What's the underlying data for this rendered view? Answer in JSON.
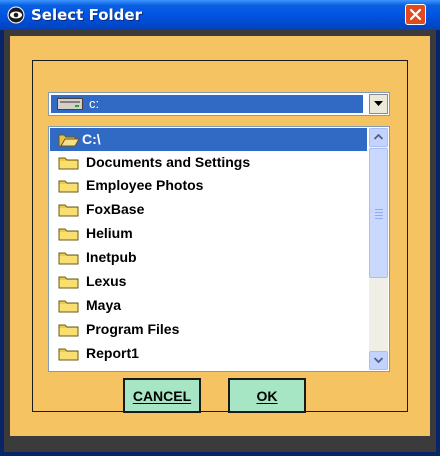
{
  "window": {
    "title": "Select Folder",
    "icons": {
      "app": "eye-icon",
      "close": "close-icon"
    },
    "colors": {
      "titlebar": "#0054e3",
      "panel": "#f5c361",
      "selection": "#316ac5",
      "button": "#a6e6c4",
      "close": "#e04a1e"
    }
  },
  "drive_combo": {
    "value": "c:",
    "icon": "drive-icon"
  },
  "folder_list": {
    "items": [
      {
        "label": "C:\\",
        "selected": true,
        "icon": "open-folder-icon"
      },
      {
        "label": "Documents and Settings",
        "icon": "folder-icon"
      },
      {
        "label": "Employee Photos",
        "icon": "folder-icon"
      },
      {
        "label": "FoxBase",
        "icon": "folder-icon"
      },
      {
        "label": "Helium",
        "icon": "folder-icon"
      },
      {
        "label": "Inetpub",
        "icon": "folder-icon"
      },
      {
        "label": "Lexus",
        "icon": "folder-icon"
      },
      {
        "label": "Maya",
        "icon": "folder-icon"
      },
      {
        "label": "Program Files",
        "icon": "folder-icon"
      },
      {
        "label": "Report1",
        "icon": "folder-icon"
      }
    ]
  },
  "buttons": {
    "cancel_label": "CANCEL",
    "ok_label": "OK"
  }
}
